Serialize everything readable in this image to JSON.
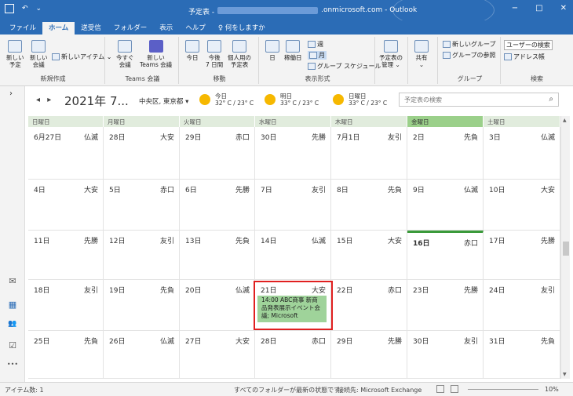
{
  "titlebar": {
    "title_prefix": "予定表 - ",
    "title_suffix": ".onmicrosoft.com - Outlook",
    "undo": "↶",
    "qat": "⌄",
    "win_min": "−",
    "win_restore": "□",
    "win_close": "✕"
  },
  "tabs": [
    "ファイル",
    "ホーム",
    "送受信",
    "フォルダー",
    "表示",
    "ヘルプ",
    "♀ 何をしますか"
  ],
  "ribbon": {
    "new_appt": "新しい\n予定",
    "new_meeting": "新しい\n会議",
    "new_items": "新しいアイテム ⌄",
    "g_new": "新規作成",
    "meet_now": "今すぐ\n会議",
    "new_teams": "新しい\nTeams 会議",
    "g_teams": "Teams 会議",
    "today": "今日",
    "next7": "今後\n7 日間",
    "personal_cal": "個人用の\n予定表",
    "g_move": "移動",
    "day": "日",
    "workweek": "稼働日",
    "week": "週",
    "month": "月",
    "group_schedule": "グループ スケジュール",
    "g_view": "表示形式",
    "manage": "予定表の\n管理 ⌄",
    "share": "共有\n⌄",
    "new_group": "新しいグループ",
    "browse_groups": "グループの参照",
    "g_groups": "グループ",
    "search_people": "ユーザーの検索",
    "address_book": "アドレス帳",
    "g_search": "検索"
  },
  "nav": {
    "range": "2021年 7...",
    "location": "中央区, 東京都  ▾",
    "prev": "◂",
    "next": "▸",
    "search_placeholder": "予定表の検索",
    "search_icon": "⌕"
  },
  "weather": [
    {
      "day": "今日",
      "temp": "32° C / 23° C"
    },
    {
      "day": "明日",
      "temp": "33° C / 23° C"
    },
    {
      "day": "日曜日",
      "temp": "33° C / 23° C"
    }
  ],
  "weekdays": [
    "日曜日",
    "月曜日",
    "火曜日",
    "水曜日",
    "木曜日",
    "金曜日",
    "土曜日"
  ],
  "weeks": [
    [
      [
        "6月27日",
        "仏滅"
      ],
      [
        "28日",
        "大安"
      ],
      [
        "29日",
        "赤口"
      ],
      [
        "30日",
        "先勝"
      ],
      [
        "7月1日",
        "友引"
      ],
      [
        "2日",
        "先負"
      ],
      [
        "3日",
        "仏滅"
      ]
    ],
    [
      [
        "4日",
        "大安"
      ],
      [
        "5日",
        "赤口"
      ],
      [
        "6日",
        "先勝"
      ],
      [
        "7日",
        "友引"
      ],
      [
        "8日",
        "先負"
      ],
      [
        "9日",
        "仏滅"
      ],
      [
        "10日",
        "大安"
      ]
    ],
    [
      [
        "11日",
        "先勝"
      ],
      [
        "12日",
        "友引"
      ],
      [
        "13日",
        "先負"
      ],
      [
        "14日",
        "仏滅"
      ],
      [
        "15日",
        "大安"
      ],
      [
        "16日",
        "赤口"
      ],
      [
        "17日",
        "先勝"
      ]
    ],
    [
      [
        "18日",
        "友引"
      ],
      [
        "19日",
        "先負"
      ],
      [
        "20日",
        "仏滅"
      ],
      [
        "21日",
        "大安"
      ],
      [
        "22日",
        "赤口"
      ],
      [
        "23日",
        "先勝"
      ],
      [
        "24日",
        "友引"
      ]
    ],
    [
      [
        "25日",
        "先負"
      ],
      [
        "26日",
        "仏滅"
      ],
      [
        "27日",
        "大安"
      ],
      [
        "28日",
        "赤口"
      ],
      [
        "29日",
        "先勝"
      ],
      [
        "30日",
        "友引"
      ],
      [
        "31日",
        "先負"
      ]
    ]
  ],
  "event": {
    "text": "14:00 ABC商事 新商品発表展示イベント会議; Microsoft"
  },
  "sidebar": {
    "chevron": "›",
    "mail": "✉",
    "calendar": "▦",
    "people": "👥",
    "tasks": "☑",
    "more": "•••"
  },
  "status": {
    "items": "アイテム数: 1",
    "sync": "すべてのフォルダーが最新の状態です。",
    "connection": "接続先: Microsoft Exchange",
    "zoom": "10%"
  },
  "colors": {
    "brand": "#2b6cb6",
    "today": "#9bd08a",
    "event": "#9fd39a",
    "highlight": "#e02020"
  }
}
